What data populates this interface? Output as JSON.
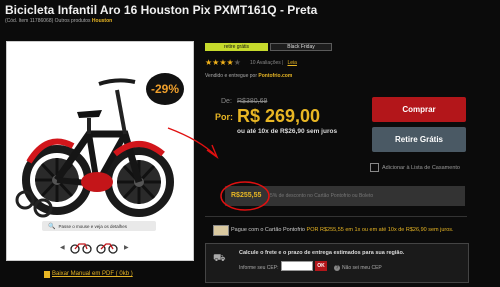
{
  "product": {
    "title": "Bicicleta Infantil Aro 16 Houston Pix PXMT161Q - Preta",
    "code_line": "(Cód. Item 11786068) Outros produtos",
    "brand": "Houston",
    "discount_badge": "-29%"
  },
  "gallery": {
    "zoom_hint": "Passe o mouse e veja os detalhes",
    "manual_link": "Baixar Manual em PDF ( 0kb )"
  },
  "tags": {
    "green": "retire grátis",
    "black": "Black Friday"
  },
  "rating": {
    "stars_on": "★★★★",
    "stars_off": "★",
    "reviews": "10 Avaliações |",
    "read_link": "Leia"
  },
  "seller": {
    "text": "Vendido e entregue por",
    "store": "Pontofrio.com"
  },
  "price": {
    "de_label": "De:",
    "old": "R$380,69",
    "por_label": "Por:",
    "new": "R$ 269,00",
    "installments": "ou até 10x de R$26,90 sem juros"
  },
  "actions": {
    "buy": "Comprar",
    "pickup": "Retire Grátis",
    "wedding": "Adicionar à Lista de Casamento"
  },
  "pix": {
    "price": "R$255,55",
    "desc": "5% de desconto no Cartão Pontofrio ou Boleto"
  },
  "card_offer": {
    "prefix": "Pague com o Cartão Pontofrio",
    "highlight": "POR R$255,55 em 1x ou em até 10x de R$26,90 sem juros."
  },
  "shipping": {
    "title": "Calcule o frete e o prazo de entrega estimados para sua região.",
    "cep_label": "Informe seu CEP:",
    "cep_value": "",
    "ok": "OK",
    "no_cep": "Não sei meu CEP"
  },
  "colors": {
    "accent": "#e8b624",
    "buy": "#b3161a",
    "pickup": "#4a5964",
    "tag_green": "#c6da2c",
    "annotation": "#e01010"
  }
}
